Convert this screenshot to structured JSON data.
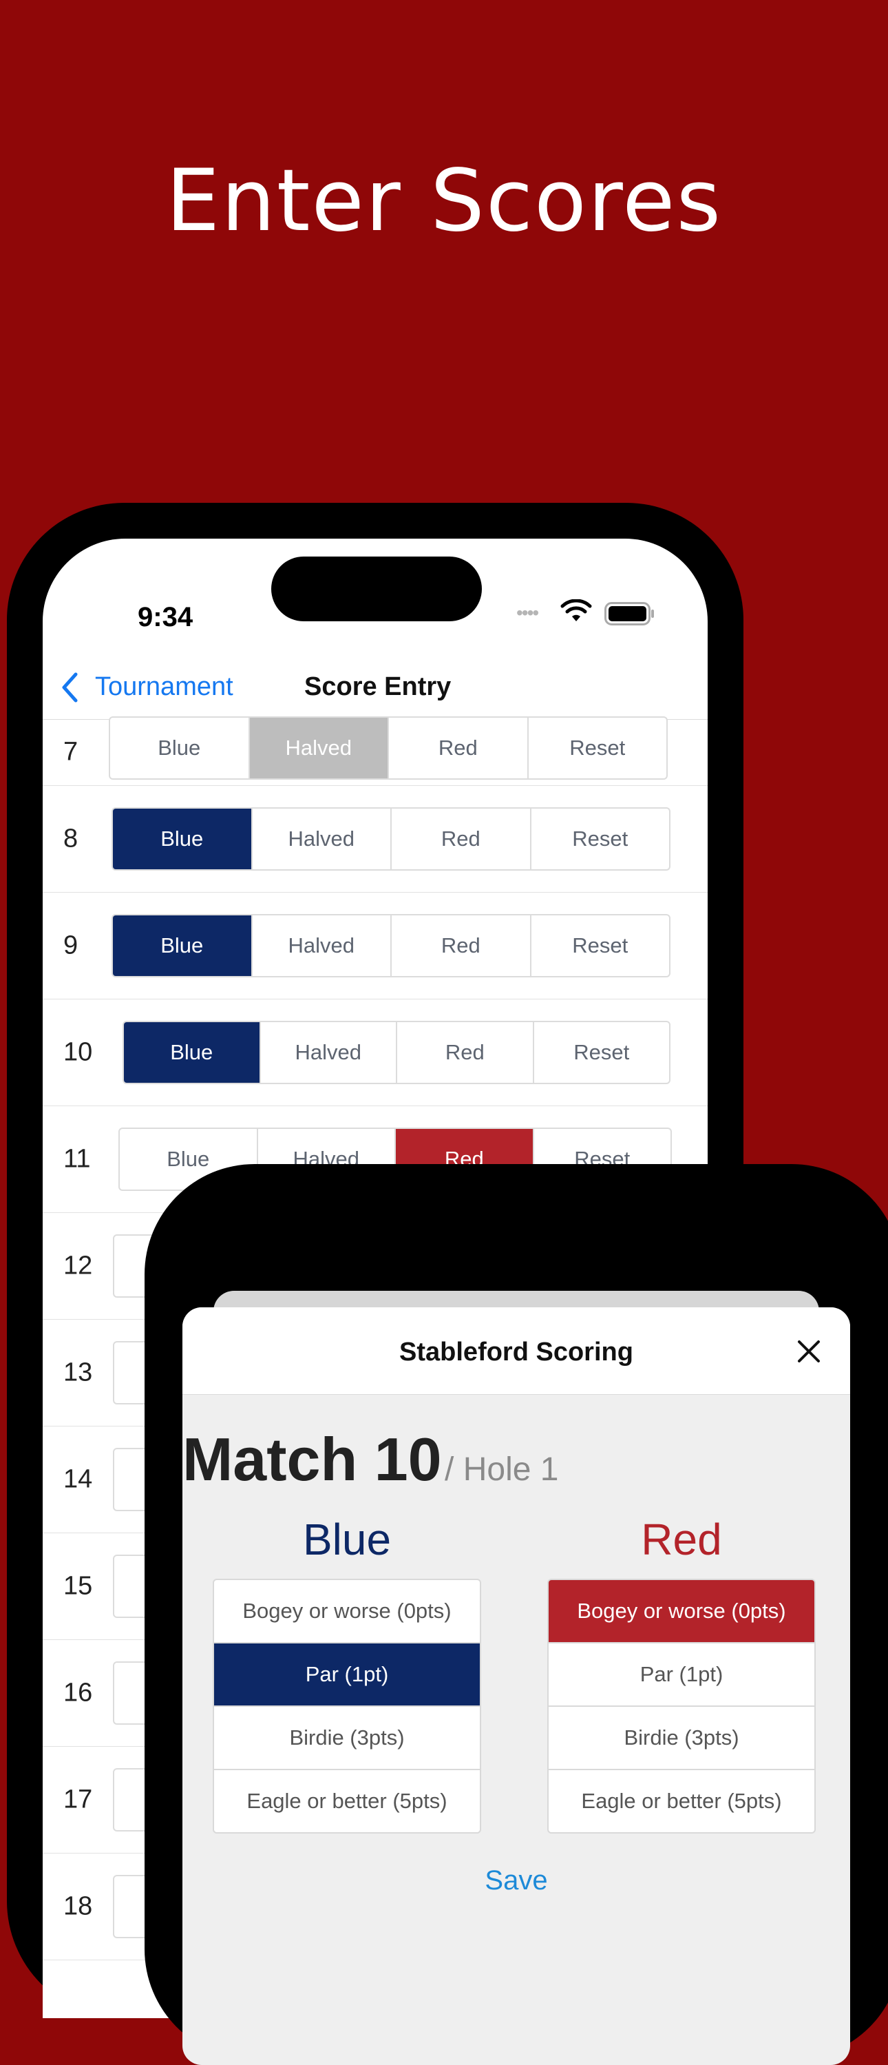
{
  "headline": "Enter Scores",
  "status_bar": {
    "time": "9:34",
    "dots": "••••"
  },
  "nav": {
    "back_label": "Tournament",
    "title": "Score Entry"
  },
  "segment_labels": [
    "Blue",
    "Halved",
    "Red",
    "Reset"
  ],
  "rows": [
    {
      "hole": "7",
      "selected": "Halved"
    },
    {
      "hole": "8",
      "selected": "Blue"
    },
    {
      "hole": "9",
      "selected": "Blue"
    },
    {
      "hole": "10",
      "selected": "Blue"
    },
    {
      "hole": "11",
      "selected": "Red"
    },
    {
      "hole": "12"
    },
    {
      "hole": "13"
    },
    {
      "hole": "14"
    },
    {
      "hole": "15"
    },
    {
      "hole": "16"
    },
    {
      "hole": "17"
    },
    {
      "hole": "18"
    }
  ],
  "sheet": {
    "title": "Stableford Scoring",
    "match": "Match 10",
    "hole": "/ Hole 1",
    "blue": {
      "title": "Blue",
      "selected": "Par (1pt)",
      "color": "#0d2866"
    },
    "red": {
      "title": "Red",
      "selected": "Bogey or worse (0pts)",
      "color": "#b3232a"
    },
    "options": [
      "Bogey or worse (0pts)",
      "Par (1pt)",
      "Birdie (3pts)",
      "Eagle or better (5pts)"
    ],
    "save_label": "Save"
  },
  "colors": {
    "background": "#8f0708",
    "blue": "#0d2866",
    "red": "#b3232a",
    "link": "#1578f0"
  }
}
